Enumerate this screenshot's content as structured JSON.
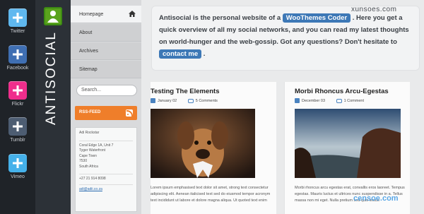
{
  "social": [
    {
      "label": "Twitter",
      "color": "#5fb8ef",
      "icon": "plus-icon"
    },
    {
      "label": "Facebook",
      "color": "#3f6fb3",
      "icon": "plus-icon"
    },
    {
      "label": "Flickr",
      "color": "#ef2e8c",
      "icon": "plus-icon"
    },
    {
      "label": "Tumblr",
      "color": "#4d5d72",
      "icon": "plus-icon"
    },
    {
      "label": "Vimeo",
      "color": "#45b1ea",
      "icon": "plus-icon"
    }
  ],
  "brand": {
    "name": "ANTISOCIAL",
    "avatar_color": "#5aa31d"
  },
  "nav": {
    "items": [
      {
        "label": "Homepage",
        "active": true
      },
      {
        "label": "About"
      },
      {
        "label": "Archives"
      },
      {
        "label": "Sitemap"
      }
    ],
    "search_placeholder": "Search...",
    "rss_label": "RSS-FEED"
  },
  "contact": {
    "name": "Adi Rockstar",
    "address": [
      "Coral Edge 1A, Unit 7",
      "Tyger Waterfront",
      "Cape Town",
      "7530",
      "South Africa"
    ],
    "phone": "+27 21 914 8098",
    "email": "adi@adii.co.za"
  },
  "intro": {
    "text_before": "Antisocial is the personal website of a",
    "chip1": "WooThemes Coder",
    "text_middle": ". Here you get a quick overview of all my social networks, and you can read my latest thoughts on world-hunger and the web-gossip. Got any questions? Don't hesitate to",
    "chip2": "contact me",
    "text_after": "."
  },
  "posts": [
    {
      "title": "Testing The Elements",
      "date": "January 02",
      "comments": "5 Comments",
      "excerpt": "Lorem ipsum emphasised text dolor sit amet, strong text consectetur adipiscing elit. Aenean italicised text sed do eiusmod tempor acronym text incididunt ut labore et dolore magna aliqua. Ut quoted text enim"
    },
    {
      "title": "Morbi Rhoncus Arcu-Egestas",
      "date": "December 03",
      "comments": "1 Comment",
      "excerpt": "Morbi rhoncus arcu egestas erat, convallis eros laoreet. Tempus egestas. Mauris luctus et ultrices nunc suspendisse in a. Tellus massa non mi eget. Nulla pretium sed quis lectus"
    }
  ],
  "watermarks": {
    "top": "xunsoes.com",
    "bottom": "censoe.com"
  }
}
